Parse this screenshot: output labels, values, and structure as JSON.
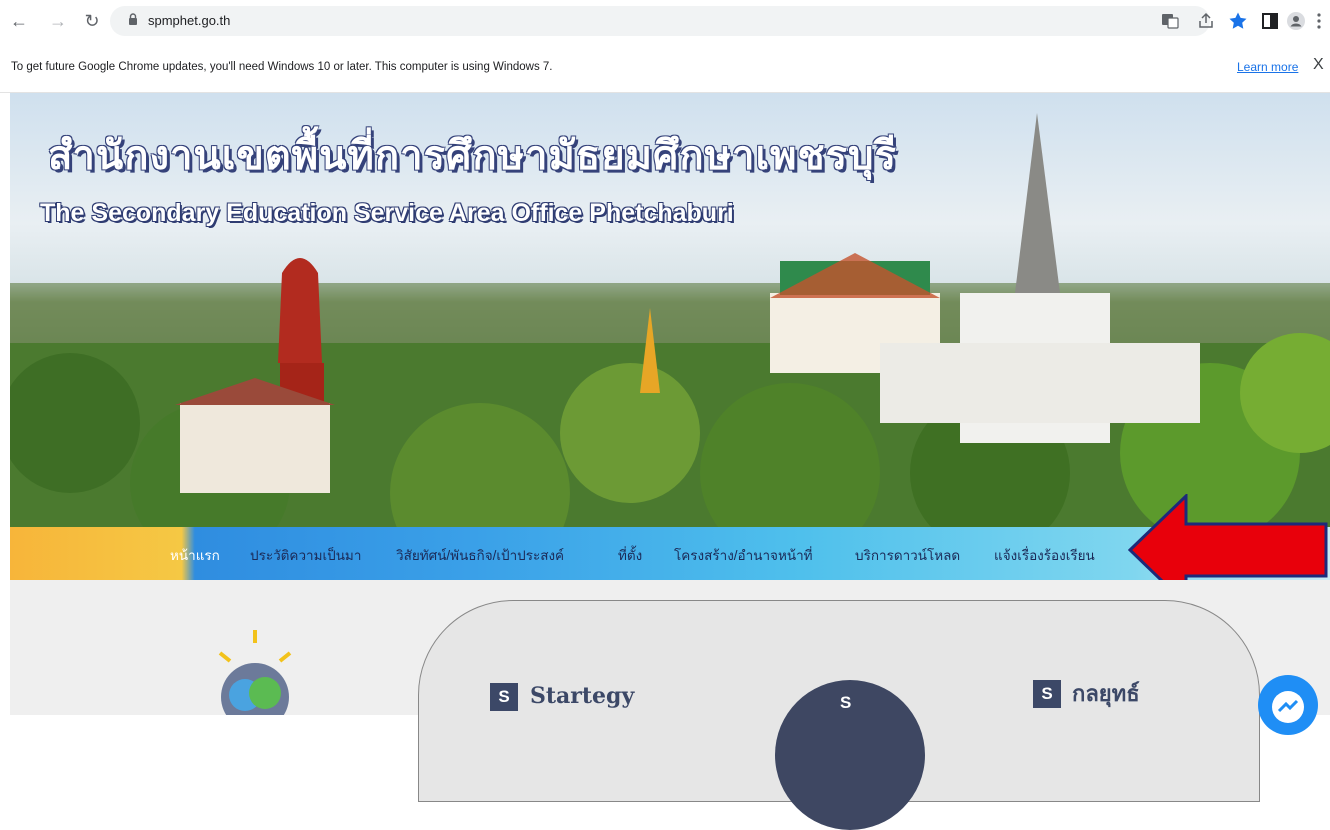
{
  "browser": {
    "url": "spmphet.go.th",
    "icons": [
      "back-icon",
      "forward-icon",
      "reload-icon",
      "lock-icon",
      "translate-icon",
      "share-icon",
      "bookmark-star-icon",
      "side-panel-icon",
      "profile-icon",
      "menu-icon"
    ]
  },
  "infobar": {
    "message": "To get future Google Chrome updates, you'll need Windows 10 or later. This computer is using Windows 7.",
    "link": "Learn more",
    "close": "X"
  },
  "banner": {
    "title_th": "สำนักงานเขตพื้นที่การศึกษามัธยมศึกษาเพชรบุรี",
    "title_en": "The Secondary Education Service Area Office Phetchaburi"
  },
  "menu": {
    "items": [
      {
        "label": "หน้าแรก"
      },
      {
        "label": "ประวัติความเป็นมา"
      },
      {
        "label": "วิสัยทัศน์/พันธกิจ/เป้าประสงค์"
      },
      {
        "label": "ที่ตั้ง"
      },
      {
        "label": "โครงสร้าง/อำนาจหน้าที่"
      },
      {
        "label": "บริการดาวน์โหลด"
      },
      {
        "label": "แจ้งเรื่องร้องเรียน"
      }
    ]
  },
  "content": {
    "badge_letter": "S",
    "strategy_label": "Startegy",
    "strategy_th_label": "กลยุทธ์",
    "center_letter": "S"
  },
  "colors": {
    "accent_red": "#e8000b",
    "menu_text": "#1b2a57",
    "badge_bg": "#3c4867"
  }
}
